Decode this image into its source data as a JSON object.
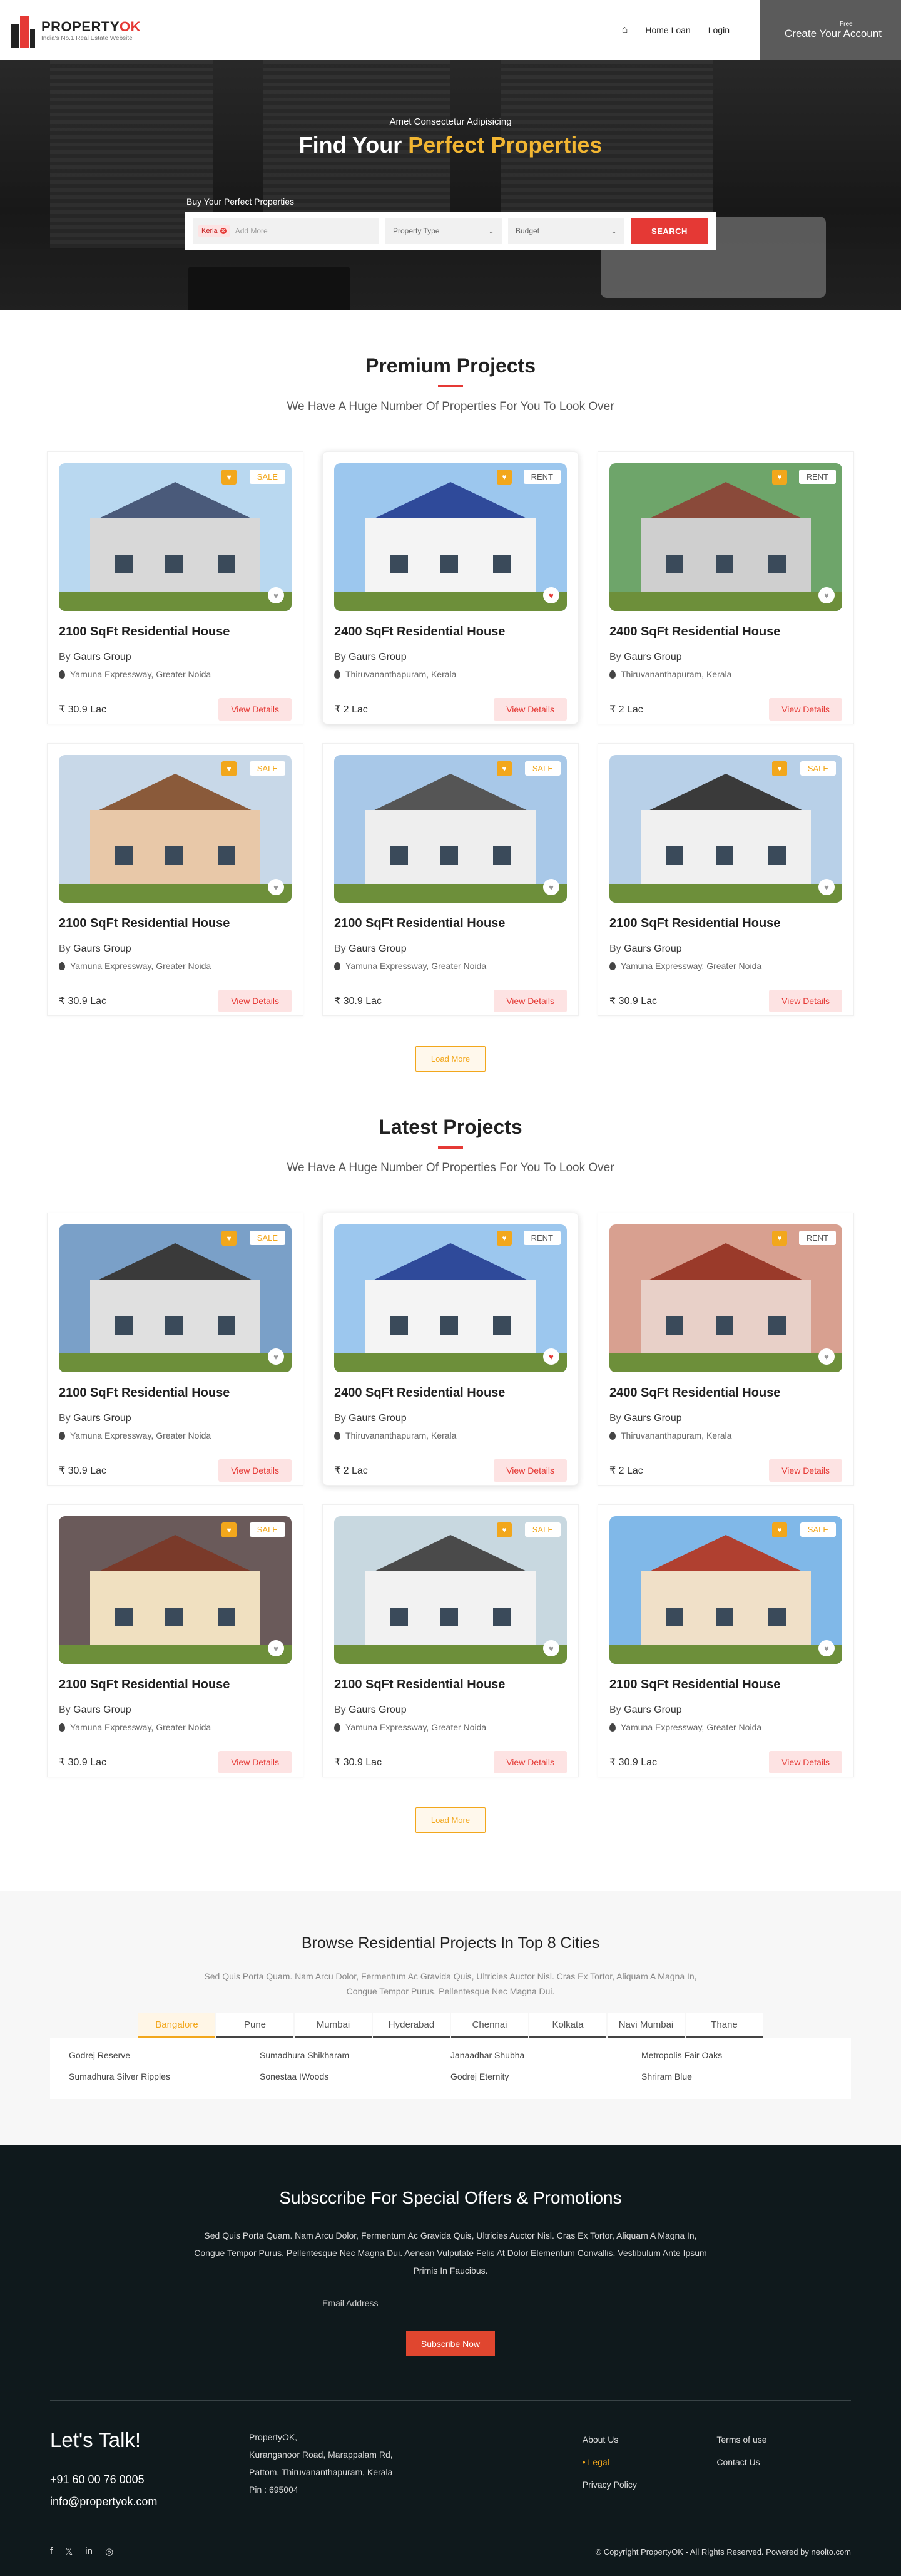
{
  "header": {
    "logo_name_a": "PROPERTY",
    "logo_name_b": "OK",
    "logo_tag": "India's No.1 Real Estate Website",
    "nav_home_icon": "home-icon",
    "nav_home_loan": "Home Loan",
    "nav_login": "Login",
    "cta_small": "Free",
    "cta_label": "Create Your Account"
  },
  "hero": {
    "subtitle": "Amet Consectetur Adipisicing",
    "title_a": "Find Your ",
    "title_b": "Perfect Properties",
    "search_label": "Buy Your Perfect Properties",
    "chip_label": "Kerla",
    "add_more_placeholder": "Add More",
    "property_type": "Property Type",
    "budget": "Budget",
    "search_button": "SEARCH"
  },
  "premium": {
    "title": "Premium Projects",
    "subtitle": "We Have A Huge Number Of Properties For You To Look Over",
    "load_more": "Load More",
    "cards": [
      {
        "title": "2100 SqFt Residential House",
        "by": "By",
        "builder": "Gaurs Group",
        "location": "Yamuna Expressway, Greater Noida",
        "price": "₹ 30.9 Lac",
        "tag": "SALE",
        "button": "View Details"
      },
      {
        "title": "2400 SqFt Residential House",
        "by": "By",
        "builder": "Gaurs Group",
        "location": "Thiruvananthapuram, Kerala",
        "price": "₹ 2 Lac",
        "tag": "RENT",
        "button": "View Details"
      },
      {
        "title": "2400 SqFt Residential House",
        "by": "By",
        "builder": "Gaurs Group",
        "location": "Thiruvananthapuram, Kerala",
        "price": "₹ 2 Lac",
        "tag": "RENT",
        "button": "View Details"
      },
      {
        "title": "2100 SqFt Residential House",
        "by": "By",
        "builder": "Gaurs Group",
        "location": "Yamuna Expressway, Greater Noida",
        "price": "₹ 30.9 Lac",
        "tag": "SALE",
        "button": "View Details"
      },
      {
        "title": "2100 SqFt Residential House",
        "by": "By",
        "builder": "Gaurs Group",
        "location": "Yamuna Expressway, Greater Noida",
        "price": "₹ 30.9 Lac",
        "tag": "SALE",
        "button": "View Details"
      },
      {
        "title": "2100 SqFt Residential House",
        "by": "By",
        "builder": "Gaurs Group",
        "location": "Yamuna Expressway, Greater Noida",
        "price": "₹ 30.9 Lac",
        "tag": "SALE",
        "button": "View Details"
      }
    ]
  },
  "latest": {
    "title": "Latest Projects",
    "subtitle": "We Have A Huge Number Of Properties For You To Look Over",
    "load_more": "Load More",
    "cards": [
      {
        "title": "2100 SqFt Residential House",
        "by": "By",
        "builder": "Gaurs Group",
        "location": "Yamuna Expressway, Greater Noida",
        "price": "₹ 30.9 Lac",
        "tag": "SALE",
        "button": "View Details"
      },
      {
        "title": "2400 SqFt Residential House",
        "by": "By",
        "builder": "Gaurs Group",
        "location": "Thiruvananthapuram, Kerala",
        "price": "₹ 2 Lac",
        "tag": "RENT",
        "button": "View Details"
      },
      {
        "title": "2400 SqFt Residential House",
        "by": "By",
        "builder": "Gaurs Group",
        "location": "Thiruvananthapuram, Kerala",
        "price": "₹ 2 Lac",
        "tag": "RENT",
        "button": "View Details"
      },
      {
        "title": "2100 SqFt Residential House",
        "by": "By",
        "builder": "Gaurs Group",
        "location": "Yamuna Expressway, Greater Noida",
        "price": "₹ 30.9 Lac",
        "tag": "SALE",
        "button": "View Details"
      },
      {
        "title": "2100 SqFt Residential House",
        "by": "By",
        "builder": "Gaurs Group",
        "location": "Yamuna Expressway, Greater Noida",
        "price": "₹ 30.9 Lac",
        "tag": "SALE",
        "button": "View Details"
      },
      {
        "title": "2100 SqFt Residential House",
        "by": "By",
        "builder": "Gaurs Group",
        "location": "Yamuna Expressway, Greater Noida",
        "price": "₹ 30.9 Lac",
        "tag": "SALE",
        "button": "View Details"
      }
    ]
  },
  "cities": {
    "title": "Browse Residential Projects In Top 8 Cities",
    "text": "Sed Quis Porta Quam. Nam Arcu Dolor, Fermentum Ac Gravida Quis, Ultricies Auctor Nisl. Cras Ex Tortor, Aliquam A Magna In, Congue Tempor Purus. Pellentesque Nec Magna Dui.",
    "tabs": [
      "Bangalore",
      "Pune",
      "Mumbai",
      "Hyderabad",
      "Chennai",
      "Kolkata",
      "Navi Mumbai",
      "Thane"
    ],
    "projects": [
      "Godrej Reserve",
      "Sumadhura Shikharam",
      "Janaadhar Shubha",
      "Metropolis Fair Oaks",
      "Sumadhura Silver Ripples",
      "Sonestaa IWoods",
      "Godrej Eternity",
      "Shriram Blue"
    ]
  },
  "footer": {
    "title": "Subsccribe For Special Offers & Promotions",
    "text": "Sed Quis Porta Quam. Nam Arcu Dolor, Fermentum Ac Gravida Quis, Ultricies Auctor Nisl. Cras Ex Tortor, Aliquam A Magna In, Congue Tempor Purus. Pellentesque Nec Magna Dui. Aenean Vulputate Felis At Dolor Elementum Convallis. Vestibulum Ante Ipsum Primis In Faucibus.",
    "email_placeholder": "Email Address",
    "subscribe": "Subscribe Now",
    "talk": "Let's Talk!",
    "phone": "+91 60 00 76 0005",
    "email": "info@propertyok.com",
    "address": [
      "PropertyOK,",
      "Kuranganoor Road, Marappalam Rd,",
      "Pattom, Thiruvananthapuram, Kerala",
      "Pin : 695004"
    ],
    "links_a": [
      "About Us",
      "Legal",
      "Privacy Policy"
    ],
    "links_b": [
      "Terms of use",
      "Contact Us"
    ],
    "copyright": "© Copyright PropertyOK - All Rights Reserved.   Powered by neolto.com",
    "social": [
      "facebook-icon",
      "twitter-icon",
      "linkedin-icon",
      "instagram-icon"
    ]
  },
  "colors": {
    "accent": "#e53935",
    "highlight": "#f2b632",
    "dark_footer": "#0f191c"
  }
}
